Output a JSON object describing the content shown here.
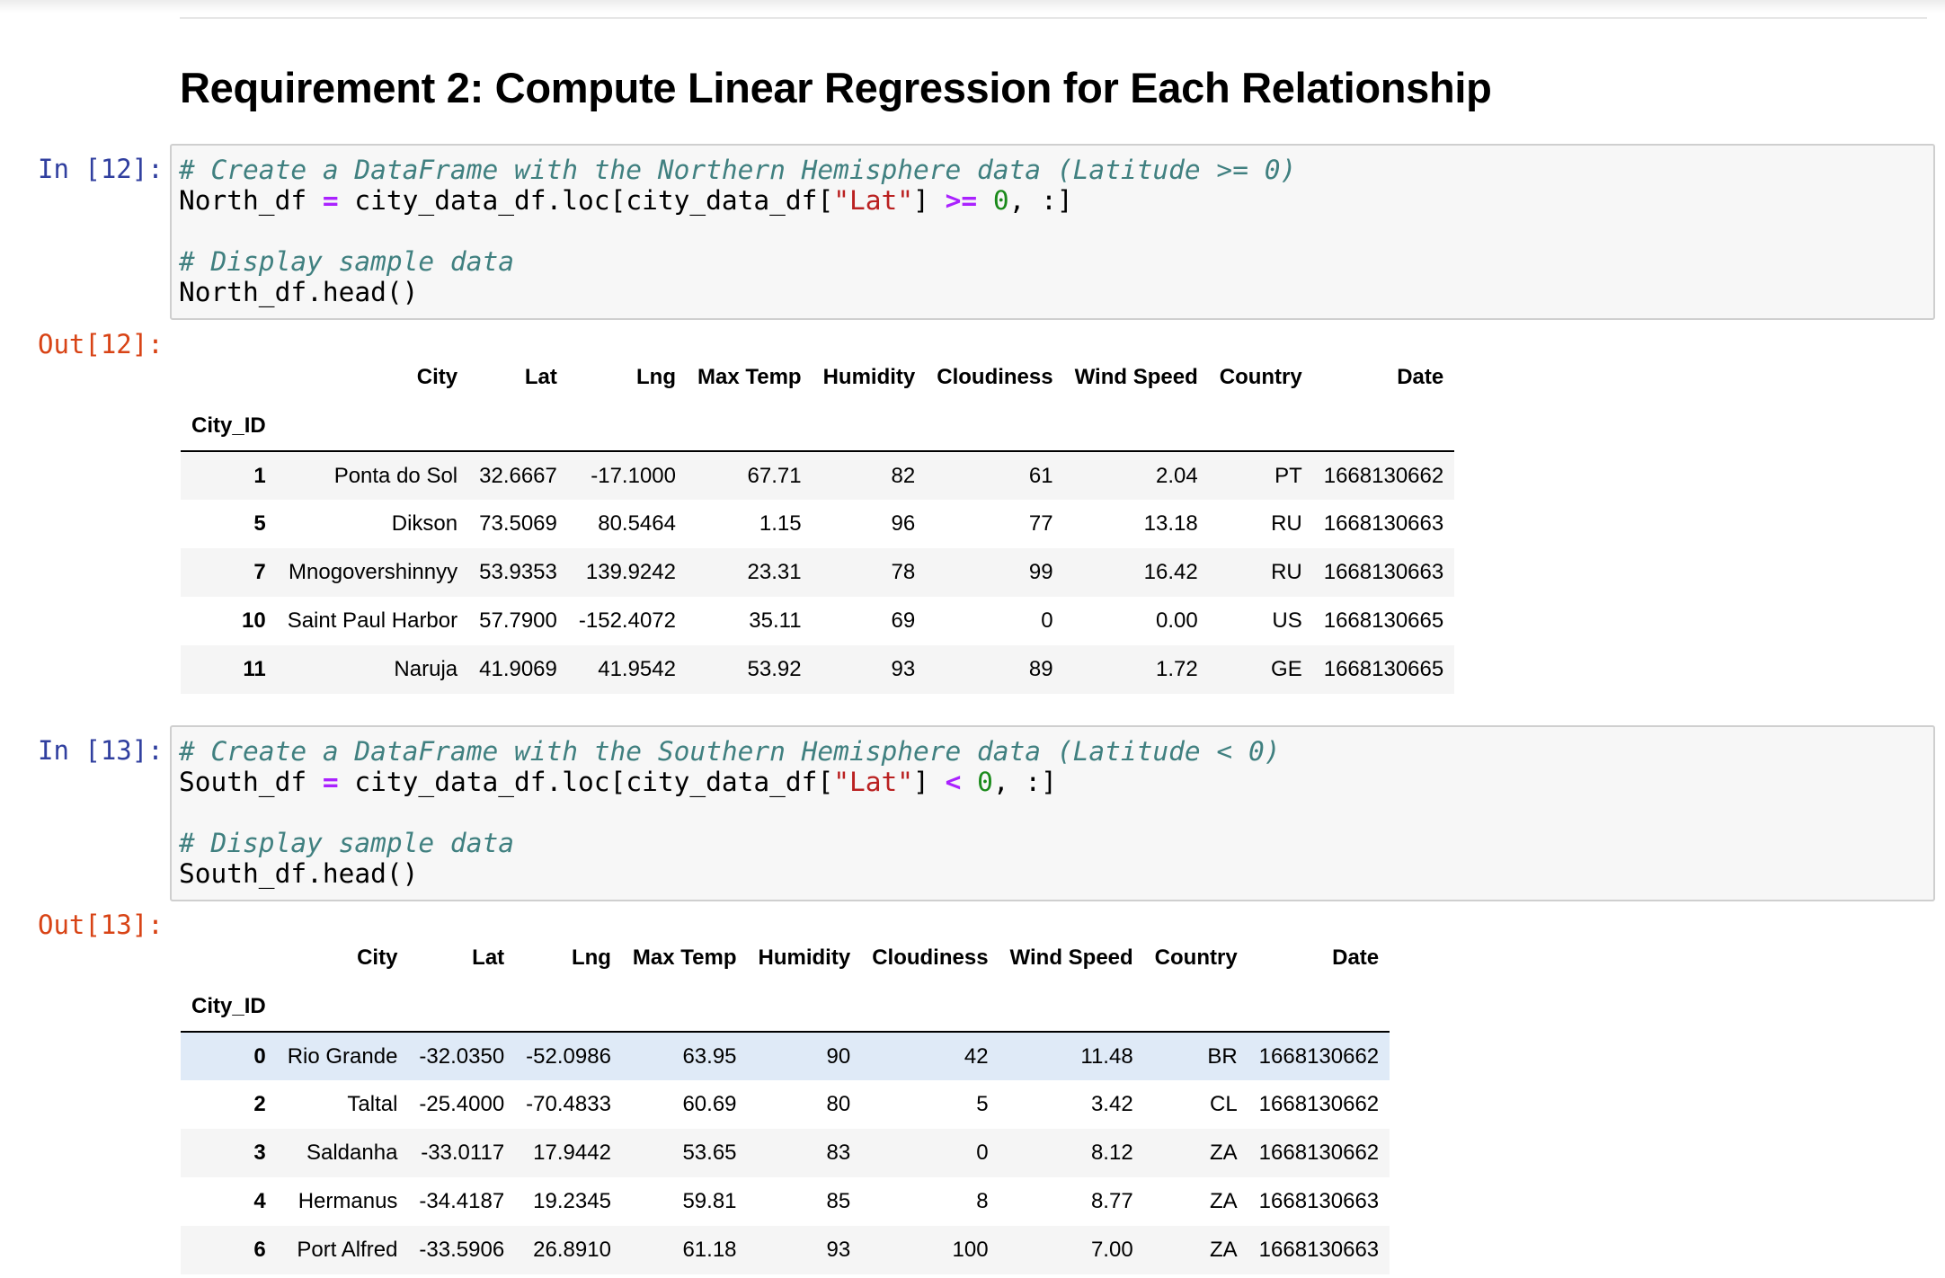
{
  "heading": "Requirement 2: Compute Linear Regression for Each Relationship",
  "cells": [
    {
      "in_prompt": "In [12]:",
      "out_prompt": "Out[12]:",
      "code": {
        "comment1": "# Create a DataFrame with the Northern Hemisphere data (Latitude >= 0)",
        "var": "North_df",
        "assign": "=",
        "expr_a": "city_data_df.loc[city_data_df[",
        "str": "\"Lat\"",
        "expr_b": "]",
        "op": ">=",
        "num": "0",
        "tail": ", :]",
        "comment2": "# Display sample data",
        "call": "North_df.head()"
      },
      "table": {
        "columns": [
          "City",
          "Lat",
          "Lng",
          "Max Temp",
          "Humidity",
          "Cloudiness",
          "Wind Speed",
          "Country",
          "Date"
        ],
        "index_name": "City_ID",
        "rows": [
          {
            "idx": "1",
            "vals": [
              "Ponta do Sol",
              "32.6667",
              "-17.1000",
              "67.71",
              "82",
              "61",
              "2.04",
              "PT",
              "1668130662"
            ]
          },
          {
            "idx": "5",
            "vals": [
              "Dikson",
              "73.5069",
              "80.5464",
              "1.15",
              "96",
              "77",
              "13.18",
              "RU",
              "1668130663"
            ]
          },
          {
            "idx": "7",
            "vals": [
              "Mnogovershinnyy",
              "53.9353",
              "139.9242",
              "23.31",
              "78",
              "99",
              "16.42",
              "RU",
              "1668130663"
            ]
          },
          {
            "idx": "10",
            "vals": [
              "Saint Paul Harbor",
              "57.7900",
              "-152.4072",
              "35.11",
              "69",
              "0",
              "0.00",
              "US",
              "1668130665"
            ]
          },
          {
            "idx": "11",
            "vals": [
              "Naruja",
              "41.9069",
              "41.9542",
              "53.92",
              "93",
              "89",
              "1.72",
              "GE",
              "1668130665"
            ]
          }
        ]
      }
    },
    {
      "in_prompt": "In [13]:",
      "out_prompt": "Out[13]:",
      "code": {
        "comment1": "# Create a DataFrame with the Southern Hemisphere data (Latitude < 0)",
        "var": "South_df",
        "assign": "=",
        "expr_a": "city_data_df.loc[city_data_df[",
        "str": "\"Lat\"",
        "expr_b": "]",
        "op": "<",
        "num": "0",
        "tail": ", :]",
        "comment2": "# Display sample data",
        "call": "South_df.head()"
      },
      "table": {
        "columns": [
          "City",
          "Lat",
          "Lng",
          "Max Temp",
          "Humidity",
          "Cloudiness",
          "Wind Speed",
          "Country",
          "Date"
        ],
        "index_name": "City_ID",
        "rows": [
          {
            "idx": "0",
            "vals": [
              "Rio Grande",
              "-32.0350",
              "-52.0986",
              "63.95",
              "90",
              "42",
              "11.48",
              "BR",
              "1668130662"
            ]
          },
          {
            "idx": "2",
            "vals": [
              "Taltal",
              "-25.4000",
              "-70.4833",
              "60.69",
              "80",
              "5",
              "3.42",
              "CL",
              "1668130662"
            ]
          },
          {
            "idx": "3",
            "vals": [
              "Saldanha",
              "-33.0117",
              "17.9442",
              "53.65",
              "83",
              "0",
              "8.12",
              "ZA",
              "1668130662"
            ]
          },
          {
            "idx": "4",
            "vals": [
              "Hermanus",
              "-34.4187",
              "19.2345",
              "59.81",
              "85",
              "8",
              "8.77",
              "ZA",
              "1668130663"
            ]
          },
          {
            "idx": "6",
            "vals": [
              "Port Alfred",
              "-33.5906",
              "26.8910",
              "61.18",
              "93",
              "100",
              "7.00",
              "ZA",
              "1668130663"
            ]
          }
        ]
      }
    }
  ]
}
